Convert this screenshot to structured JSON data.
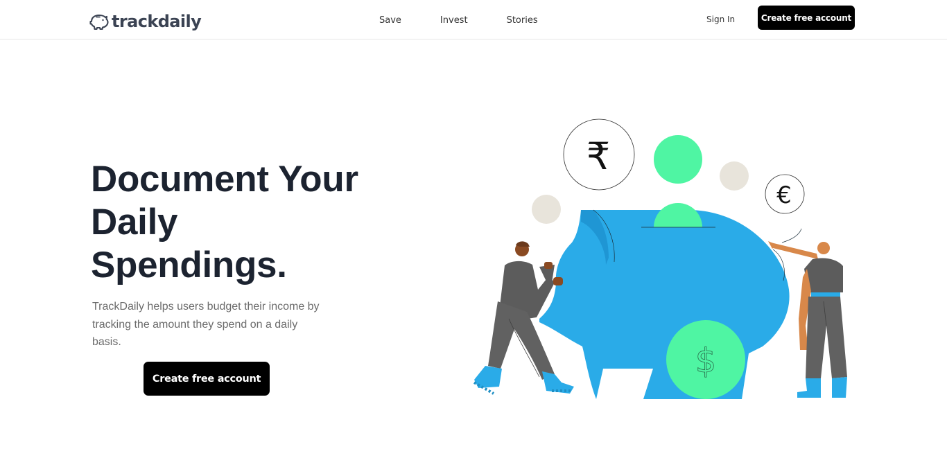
{
  "brand": {
    "name": "trackdaily",
    "logo_icon": "piggy-bank-icon",
    "text_color": "#3b4353"
  },
  "nav": {
    "links": [
      "Save",
      "Invest",
      "Stories"
    ],
    "sign_in": "Sign In",
    "cta": "Create free account"
  },
  "hero": {
    "title_lines": [
      "Document Your",
      "Daily",
      "Spendings."
    ],
    "description": "TrackDaily helps users budget their income by tracking the amount they spend on a daily basis.",
    "cta": "Create free account"
  },
  "illustration": {
    "subject": "piggy-bank-illustration",
    "currency_symbols": [
      "₹",
      "€",
      "$"
    ],
    "colors": {
      "piggy": "#2aabe8",
      "coin_green": "#4ff5a3",
      "coin_beige": "#e8e4db",
      "figure_dark": "#5c5c5c",
      "boots": "#2aabe8"
    }
  },
  "theme": {
    "button_bg": "#000000",
    "button_text": "#ffffff",
    "heading": "#1c2330",
    "body_text": "#6b6b6b",
    "divider": "#e6e6e6"
  }
}
